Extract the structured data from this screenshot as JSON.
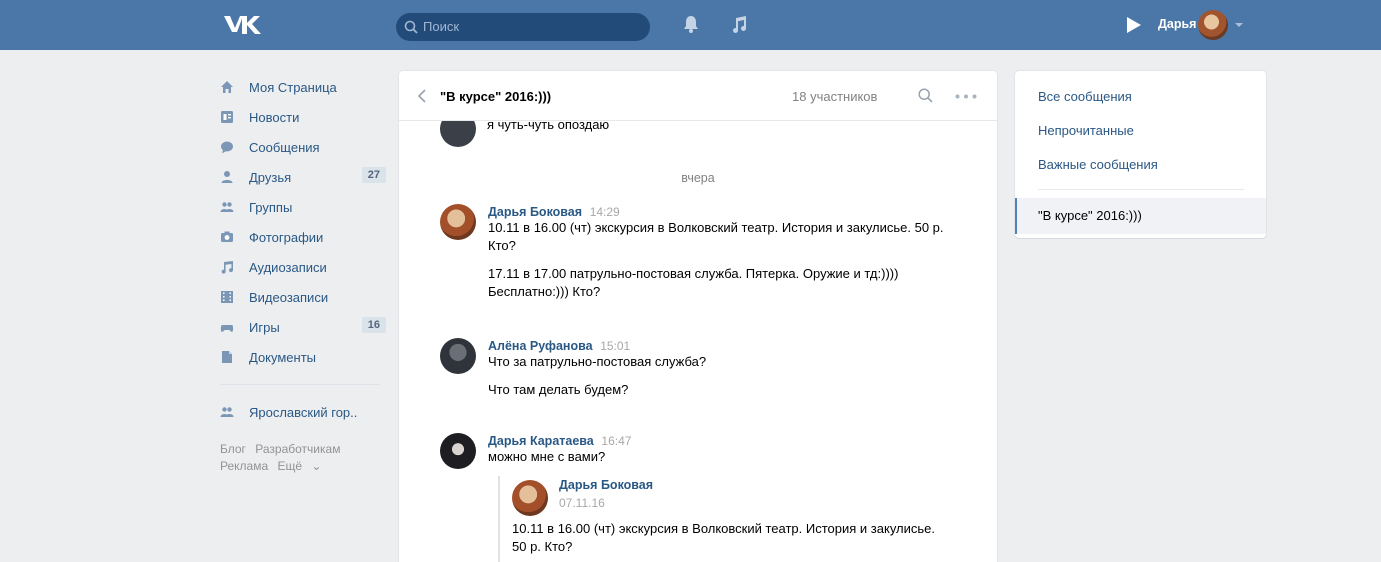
{
  "topbar": {
    "search_placeholder": "Поиск",
    "user_name": "Дарья"
  },
  "leftmenu": {
    "items": [
      {
        "label": "Моя Страница",
        "icon": "home-icon",
        "count": ""
      },
      {
        "label": "Новости",
        "icon": "news-icon",
        "count": ""
      },
      {
        "label": "Сообщения",
        "icon": "messages-icon",
        "count": ""
      },
      {
        "label": "Друзья",
        "icon": "friends-icon",
        "count": "27"
      },
      {
        "label": "Группы",
        "icon": "groups-icon",
        "count": ""
      },
      {
        "label": "Фотографии",
        "icon": "camera-icon",
        "count": ""
      },
      {
        "label": "Аудиозаписи",
        "icon": "music-icon",
        "count": ""
      },
      {
        "label": "Видеозаписи",
        "icon": "video-icon",
        "count": ""
      },
      {
        "label": "Игры",
        "icon": "gamepad-icon",
        "count": "16"
      },
      {
        "label": "Документы",
        "icon": "document-icon",
        "count": ""
      }
    ],
    "group": "Ярославский гор..",
    "footer": [
      "Блог",
      "Разработчикам",
      "Реклама",
      "Ещё"
    ]
  },
  "chat": {
    "title": "\"В курсе\" 2016:)))",
    "members": "18 участников",
    "prev_text": "я чуть-чуть опоздаю",
    "day": "вчера",
    "messages": [
      {
        "author": "Дарья Боковая",
        "time": "14:29",
        "texts": [
          "10.11 в 16.00 (чт) экскурсия в Волковский театр. История и закулисье. 50 р. Кто?",
          "17.11 в 17.00 патрульно-постовая служба. Пятерка. Оружие и тд:)))) Бесплатно:))) Кто?"
        ]
      },
      {
        "author": "Алёна Руфанова",
        "time": "15:01",
        "texts": [
          "Что за патрульно-постовая служба?",
          "Что там делать будем?"
        ]
      },
      {
        "author": "Дарья Каратаева",
        "time": "16:47",
        "texts": [
          "можно мне с вами?"
        ],
        "quote": {
          "author": "Дарья Боковая",
          "date": "07.11.16",
          "text": "10.11 в 16.00 (чт) экскурсия в Волковский театр. История и закулисье. 50 р. Кто?"
        }
      }
    ]
  },
  "filters": {
    "all": "Все сообщения",
    "unread": "Непрочитанные",
    "important": "Важные сообщения",
    "selected_chat": "\"В курсе\" 2016:)))"
  },
  "colors": {
    "header": "#4a76a8",
    "link": "#2a5885",
    "background": "#edeef0"
  }
}
